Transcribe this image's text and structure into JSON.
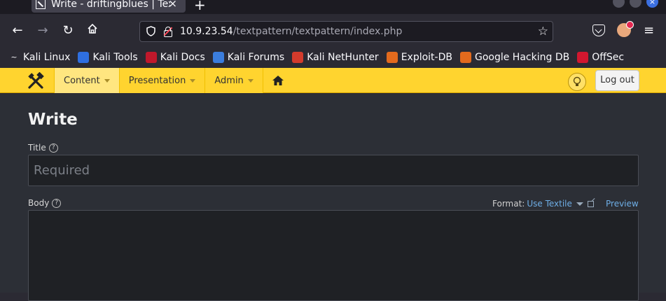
{
  "browser": {
    "tab_title": "Write - driftingblues | Textpattern",
    "tab_close": "×",
    "new_tab": "+",
    "url_host": "10.9.23.54",
    "url_path": "/textpattern/textpattern/index.php"
  },
  "bookmarks": [
    {
      "label": "Kali Linux",
      "icon": "kali-dragon-icon",
      "color": "#ffffff"
    },
    {
      "label": "Kali Tools",
      "icon": "kali-tools-icon",
      "color": "#2f6fe0"
    },
    {
      "label": "Kali Docs",
      "icon": "kali-docs-icon",
      "color": "#c0182b"
    },
    {
      "label": "Kali Forums",
      "icon": "kali-forums-icon",
      "color": "#3b7ddd"
    },
    {
      "label": "Kali NetHunter",
      "icon": "nethunter-icon",
      "color": "#d33b2c"
    },
    {
      "label": "Exploit-DB",
      "icon": "exploit-db-icon",
      "color": "#e36a1d"
    },
    {
      "label": "Google Hacking DB",
      "icon": "ghdb-icon",
      "color": "#e36a1d"
    },
    {
      "label": "OffSec",
      "icon": "offsec-icon",
      "color": "#d2172f"
    }
  ],
  "tp_nav": {
    "content": "Content",
    "presentation": "Presentation",
    "admin": "Admin",
    "logout": "Log out",
    "tip": "?"
  },
  "page": {
    "title": "Write",
    "title_label": "Title",
    "title_placeholder": "Required",
    "body_label": "Body",
    "format_label": "Format:",
    "format_value": "Use Textile",
    "preview": "Preview"
  },
  "colors": {
    "accent": "#ffd42f",
    "link": "#6eaee6",
    "background": "#2c2f36"
  }
}
